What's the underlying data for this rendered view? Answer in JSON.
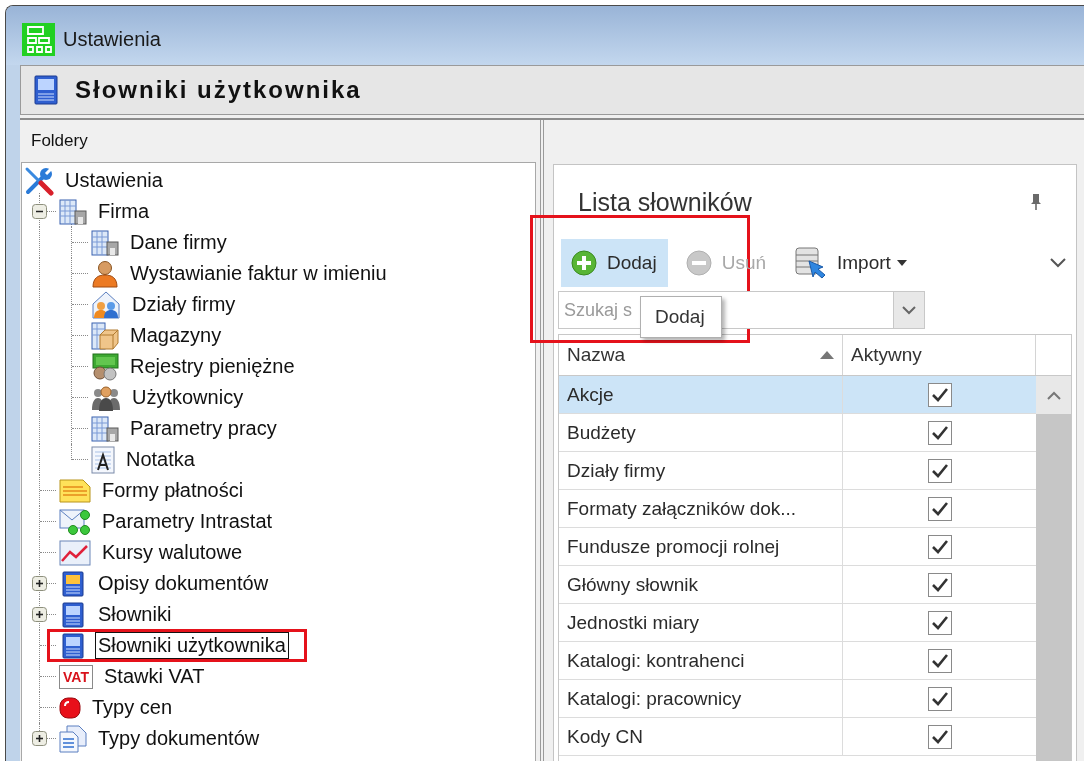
{
  "window": {
    "title": "Ustawienia"
  },
  "header": {
    "title": "Słowniki użytkownika"
  },
  "folders": {
    "title": "Foldery",
    "tree": [
      {
        "label": "Ustawienia",
        "selected": false,
        "highlighted": false,
        "children": [
          {
            "label": "Firma",
            "selected": false,
            "highlighted": false,
            "expanded": true,
            "children": [
              {
                "label": "Dane firmy",
                "selected": false,
                "highlighted": false
              },
              {
                "label": "Wystawianie faktur w imieniu",
                "selected": false,
                "highlighted": false
              },
              {
                "label": "Działy firmy",
                "selected": false,
                "highlighted": false
              },
              {
                "label": "Magazyny",
                "selected": false,
                "highlighted": false
              },
              {
                "label": "Rejestry pieniężne",
                "selected": false,
                "highlighted": false
              },
              {
                "label": "Użytkownicy",
                "selected": false,
                "highlighted": false
              },
              {
                "label": "Parametry pracy",
                "selected": false,
                "highlighted": false
              },
              {
                "label": "Notatka",
                "selected": false,
                "highlighted": false
              }
            ]
          },
          {
            "label": "Formy płatności",
            "selected": false,
            "highlighted": false
          },
          {
            "label": "Parametry Intrastat",
            "selected": false,
            "highlighted": false
          },
          {
            "label": "Kursy walutowe",
            "selected": false,
            "highlighted": false
          },
          {
            "label": "Opisy dokumentów",
            "selected": false,
            "highlighted": false,
            "expanded": false
          },
          {
            "label": "Słowniki",
            "selected": false,
            "highlighted": false,
            "expanded": false
          },
          {
            "label": "Słowniki użytkownika",
            "selected": true,
            "highlighted": true
          },
          {
            "label": "Stawki VAT",
            "selected": false,
            "highlighted": false,
            "badge": "VAT"
          },
          {
            "label": "Typy cen",
            "selected": false,
            "highlighted": false
          },
          {
            "label": "Typy dokumentów",
            "selected": false,
            "highlighted": false,
            "expanded": false
          }
        ]
      }
    ]
  },
  "dictionaries": {
    "title": "Lista słowników",
    "toolbar": [
      {
        "label": "Dodaj",
        "hovered": true,
        "disabled": false,
        "dropdown": false,
        "highlighted": true
      },
      {
        "label": "Usuń",
        "hovered": false,
        "disabled": true,
        "dropdown": false,
        "highlighted": false
      },
      {
        "label": "Import",
        "hovered": false,
        "disabled": false,
        "dropdown": true,
        "highlighted": false
      }
    ],
    "tooltip": "Dodaj",
    "search": {
      "placeholder": "Szukaj s"
    },
    "table": {
      "columns": [
        {
          "label": "Nazwa",
          "sorted": true
        },
        {
          "label": "Aktywny",
          "sorted": false
        }
      ],
      "rows": [
        {
          "name": "Akcje",
          "active": true,
          "selected": true
        },
        {
          "name": "Budżety",
          "active": true,
          "selected": false
        },
        {
          "name": "Działy firmy",
          "active": true,
          "selected": false
        },
        {
          "name": "Formaty załączników dok...",
          "active": true,
          "selected": false
        },
        {
          "name": "Fundusze promocji rolnej",
          "active": true,
          "selected": false
        },
        {
          "name": "Główny słownik",
          "active": true,
          "selected": false
        },
        {
          "name": "Jednostki miary",
          "active": true,
          "selected": false
        },
        {
          "name": "Katalogi: kontrahenci",
          "active": true,
          "selected": false
        },
        {
          "name": "Katalogi: pracownicy",
          "active": true,
          "selected": false
        },
        {
          "name": "Kody CN",
          "active": true,
          "selected": false
        }
      ]
    }
  }
}
